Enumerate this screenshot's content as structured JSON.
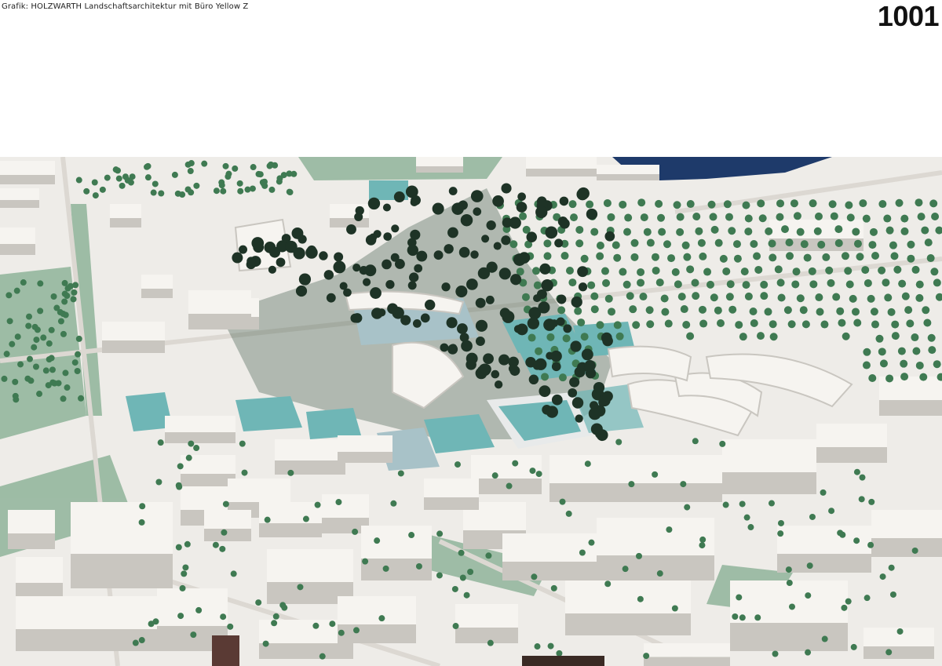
{
  "caption": {
    "credit": "Grafik: HOLZWARTH Landschaftsarchitektur mit Büro Yellow Z",
    "number": "1001"
  },
  "photo": {
    "subject": "model",
    "colors": {
      "base": "#eeece8",
      "building": "#f6f4f0",
      "building_shadow": "#c9c6c0",
      "tree_dark": "#1e3326",
      "tree_green": "#3f7a52",
      "lawn": "#8fb49a",
      "sport_field": "#6fb6b6",
      "water": "#1e3a6a"
    }
  }
}
